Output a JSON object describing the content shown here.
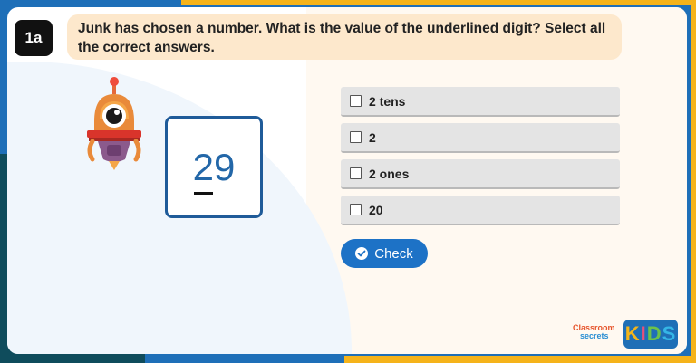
{
  "question": {
    "number": "1a",
    "text": "Junk has chosen a number. What is the value of the underlined digit? Select all the correct answers."
  },
  "number_card": {
    "underlined_digit": "2",
    "rest_digits": "9"
  },
  "options": [
    {
      "label": "2 tens",
      "checked": false
    },
    {
      "label": "2",
      "checked": false
    },
    {
      "label": "2 ones",
      "checked": false
    },
    {
      "label": "20",
      "checked": false
    }
  ],
  "check_button": {
    "label": "Check"
  },
  "brand": {
    "line1": "Classroom",
    "line2": "secrets",
    "kids_k": "K",
    "kids_i": "I",
    "kids_d": "D",
    "kids_s": "S"
  },
  "colors": {
    "accent_blue": "#1d72c6",
    "frame_blue": "#1e6fb8",
    "frame_yellow": "#f5b31a",
    "question_bg": "#fde8cc",
    "number_border": "#1f5b99"
  },
  "icons": {
    "character": "robot-character-icon",
    "check": "check-circle-icon"
  }
}
